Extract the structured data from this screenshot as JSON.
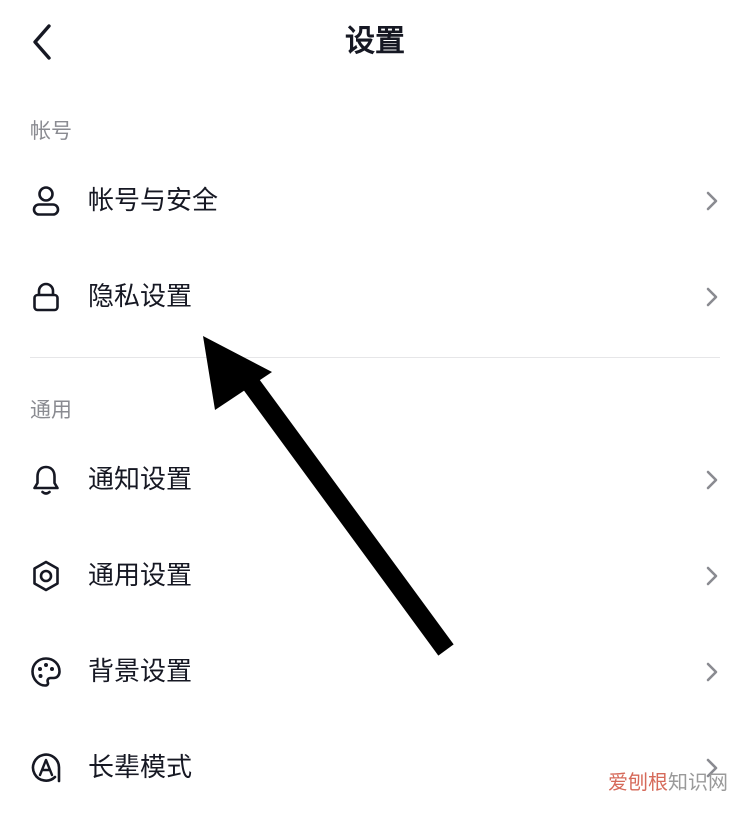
{
  "header": {
    "title": "设置",
    "back_icon": "chevron-left-icon"
  },
  "sections": [
    {
      "label": "帐号",
      "items": [
        {
          "label": "帐号与安全",
          "icon": "user-icon"
        },
        {
          "label": "隐私设置",
          "icon": "lock-icon"
        }
      ]
    },
    {
      "label": "通用",
      "items": [
        {
          "label": "通知设置",
          "icon": "bell-icon"
        },
        {
          "label": "通用设置",
          "icon": "gear-icon"
        },
        {
          "label": "背景设置",
          "icon": "palette-icon"
        },
        {
          "label": "长辈模式",
          "icon": "elder-mode-icon"
        }
      ]
    }
  ],
  "annotation": {
    "icon": "arrow-pointer-icon",
    "color": "#000000"
  },
  "watermark": {
    "accent_text": "爱刨根",
    "text": "知识网",
    "accent_color": "#d66a5a"
  },
  "colors": {
    "text_primary": "#161823",
    "text_secondary": "#8a8b91",
    "divider": "#e6e6e8",
    "chevron": "#8a8b91"
  }
}
